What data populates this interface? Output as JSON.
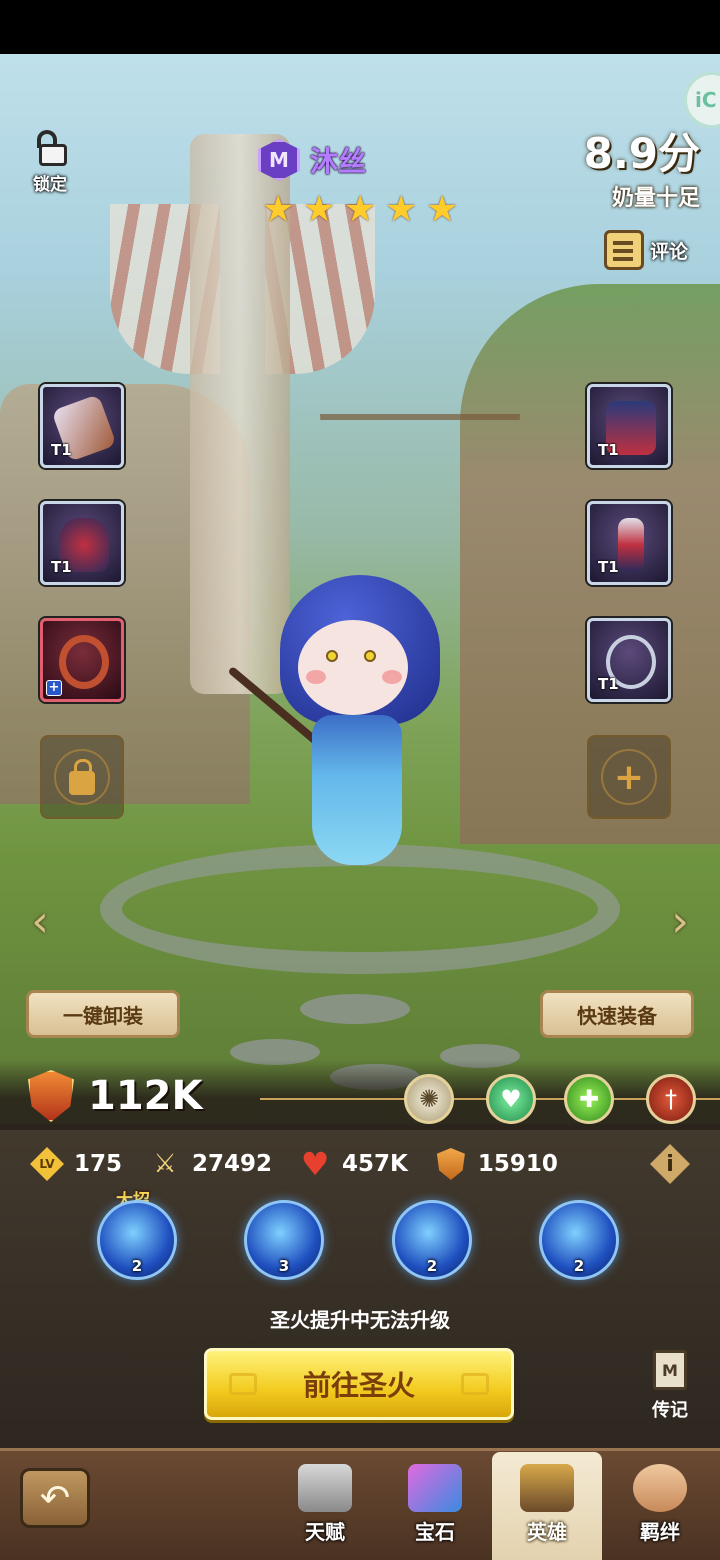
{
  "hero": {
    "name": "沐丝",
    "class_badge": "M",
    "stars": 5,
    "star_glyph": "★"
  },
  "lock": {
    "label": "锁定"
  },
  "rating": {
    "score": "8.9分",
    "tagline": "奶量十足"
  },
  "comment": {
    "label": "评论"
  },
  "equipment": {
    "left": [
      {
        "name": "staff",
        "tier": "T1"
      },
      {
        "name": "helmet",
        "tier": "T1"
      },
      {
        "name": "ring",
        "tier": "",
        "badge": "+"
      }
    ],
    "right": [
      {
        "name": "armor",
        "tier": "T1"
      },
      {
        "name": "boots",
        "tier": "T1"
      },
      {
        "name": "necklace",
        "tier": "T1"
      }
    ]
  },
  "buttons": {
    "unequip_all": "一键卸装",
    "quick_equip": "快速装备",
    "go_holy_fire": "前往圣火"
  },
  "power": {
    "value": "112K"
  },
  "stats": {
    "lv_icon": "LV",
    "level": "175",
    "attack": "27492",
    "hp": "457K",
    "defense": "15910",
    "info_icon": "i"
  },
  "skills": {
    "ultimate_label": "大招",
    "levels": [
      "2",
      "3",
      "2",
      "2"
    ]
  },
  "hint": "圣火提升中无法升级",
  "biography": {
    "icon": "M",
    "label": "传记"
  },
  "tabs": [
    {
      "label": "天赋"
    },
    {
      "label": "宝石"
    },
    {
      "label": "英雄"
    },
    {
      "label": "羁绊"
    }
  ],
  "arrows": {
    "left": "‹",
    "right": "›"
  },
  "back_icon": "↶",
  "side_button": "iC"
}
